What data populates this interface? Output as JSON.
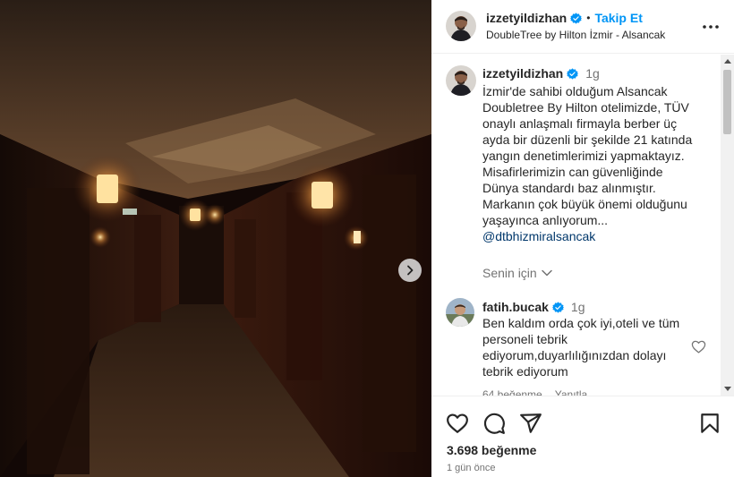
{
  "post": {
    "author": "izzetyildizhan",
    "follow_label": "Takip Et",
    "separator": "•",
    "location": "DoubleTree by Hilton İzmir - Alsancak"
  },
  "caption": {
    "author": "izzetyildizhan",
    "time": "1g",
    "lines": [
      "İzmir'de sahibi olduğum Alsancak",
      "Doubletree By Hilton otelimizde, TÜV",
      "onaylı anlaşmalı firmayla berber üç",
      "ayda bir düzenli bir şekilde 21 katında",
      "yangın denetimlerimizi yapmaktayız.",
      "Misafirlerimizin can güvenliğinde",
      "Dünya standardı baz alınmıştır.",
      "Markanın çok büyük önemi olduğunu",
      "yaşayınca anlıyorum..."
    ],
    "mention": "@dtbhizmiralsancak",
    "for_you_label": "Senin için"
  },
  "comment": {
    "author": "fatih.bucak",
    "time": "1g",
    "lines": [
      "Ben kaldım orda çok iyi,oteli ve tüm",
      "personeli tebrik",
      "ediyorum,duyarlılığınızdan dolayı",
      "tebrik ediyorum"
    ],
    "likes": "64 beğenme",
    "reply_label": "Yanıtla"
  },
  "footer": {
    "likes": "3.698 beğenme",
    "time_ago": "1 gün önce"
  },
  "icons": {
    "verified": "verified-badge-icon",
    "more": "more-options-icon",
    "next": "chevron-right-icon",
    "like": "heart-icon",
    "comment": "comment-bubble-icon",
    "share": "paper-plane-icon",
    "save": "bookmark-icon"
  },
  "colors": {
    "accent": "#0095f6",
    "mention": "#00376b",
    "verified": "#0095f6",
    "muted": "#737373"
  }
}
